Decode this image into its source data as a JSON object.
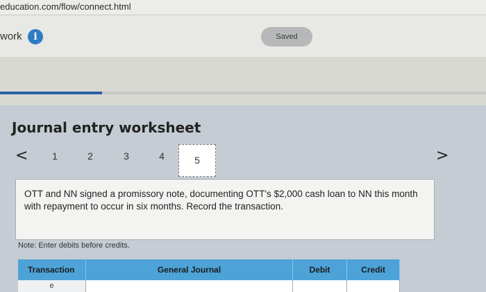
{
  "browser": {
    "url": "education.com/flow/connect.html"
  },
  "header": {
    "work_label": "work",
    "info_icon": "i",
    "saved_label": "Saved"
  },
  "progress": {
    "fraction": 0.21
  },
  "worksheet": {
    "title": "Journal entry worksheet",
    "prev_icon": "<",
    "next_icon": ">",
    "steps": [
      "1",
      "2",
      "3",
      "4",
      "5"
    ],
    "active_step": "5",
    "prompt": "OTT and NN signed a promissory note, documenting OTT's $2,000 cash loan to NN this month with repayment to occur in six months. Record the transaction.",
    "note": "Note: Enter debits before credits.",
    "table": {
      "headers": [
        "Transaction",
        "General Journal",
        "Debit",
        "Credit"
      ],
      "row": {
        "transaction": "e"
      }
    }
  }
}
